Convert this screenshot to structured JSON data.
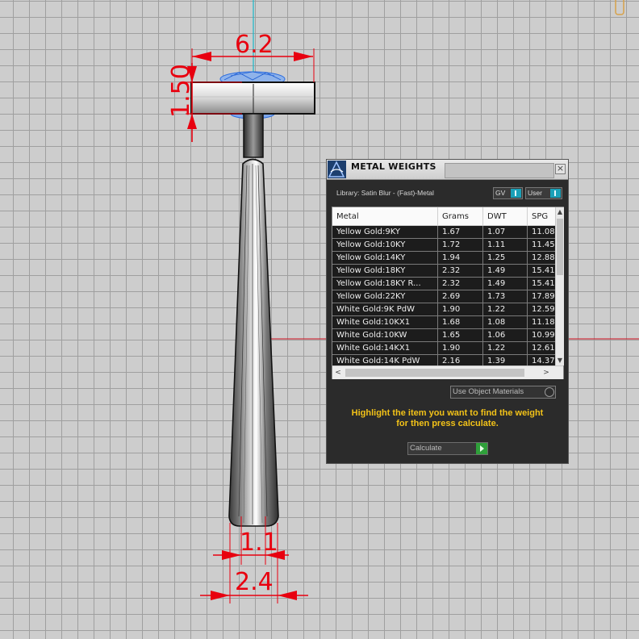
{
  "viewport": {
    "dimensions": {
      "top_width": "6.2",
      "top_height": "1.50",
      "inner_width": "1.1",
      "outer_width": "2.4"
    }
  },
  "panel": {
    "title": "METAL WEIGHTS",
    "close": "×",
    "library": "Library: Satin Blur - (Fast)-Metal",
    "gv_label": "GV",
    "user_label": "User",
    "columns": [
      "Metal",
      "Grams",
      "DWT",
      "SPG"
    ],
    "rows": [
      [
        "Yellow Gold:9KY",
        "1.67",
        "1.07",
        "11.08"
      ],
      [
        "Yellow Gold:10KY",
        "1.72",
        "1.11",
        "11.45"
      ],
      [
        "Yellow Gold:14KY",
        "1.94",
        "1.25",
        "12.88"
      ],
      [
        "Yellow Gold:18KY",
        "2.32",
        "1.49",
        "15.41"
      ],
      [
        "Yellow Gold:18KY R...",
        "2.32",
        "1.49",
        "15.41"
      ],
      [
        "Yellow Gold:22KY",
        "2.69",
        "1.73",
        "17.89"
      ],
      [
        "White Gold:9K PdW",
        "1.90",
        "1.22",
        "12.59"
      ],
      [
        "White Gold:10KX1",
        "1.68",
        "1.08",
        "11.18"
      ],
      [
        "White Gold:10KW",
        "1.65",
        "1.06",
        "10.99"
      ],
      [
        "White Gold:14KX1",
        "1.90",
        "1.22",
        "12.61"
      ],
      [
        "White Gold:14K PdW",
        "2.16",
        "1.39",
        "14.37"
      ]
    ],
    "use_object_materials": "Use Object Materials",
    "instructions_line1": "Highlight the item you want to find the weight",
    "instructions_line2": "for then press calculate.",
    "calculate_label": "Calculate"
  }
}
